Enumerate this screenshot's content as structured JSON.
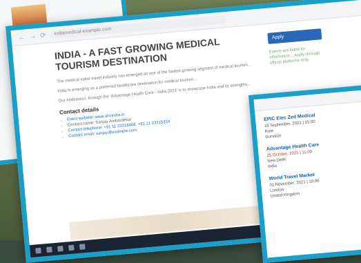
{
  "main": {
    "address": "indiamedical-example.com",
    "title": "INDIA - A FAST GROWING MEDICAL TOURISM DESTINATION",
    "paragraphs": [
      "The medical value travel industry has emerged as one of the fastest growing segment of medical tourism...",
      "India is emerging as a preferred healthcare destination for medical tourism...",
      "Our endeavour, through the 'Advantage Health Care - India 2021' is to showcase India and its strengths..."
    ],
    "contact_heading": "Contact details",
    "contact_items": [
      "Event website: www.ahcindia.in",
      "Contact name: Sanjay Ambardekar",
      "Contact telephone: +91 11 23316468, +91 11 23315334",
      "Contact email: sanjay@example.com"
    ],
    "apply_label": "Apply",
    "side_text": "Events are listed for information... Apply through official platforms only."
  },
  "right": {
    "title": "EPIC Elec Zed Medical",
    "date": "18 September, 2021 | 15:00",
    "label_rate": "Rate",
    "label_duration": "Duration",
    "section1": {
      "title": "Advantage Health Care",
      "date": "25 October, 2021 | 11:00",
      "city": "New Delhi",
      "country": "India"
    },
    "section2": {
      "title": "World Travel Market",
      "date": "01 November, 2021 | 10:00",
      "city": "London",
      "country": "United Kingdom"
    }
  }
}
